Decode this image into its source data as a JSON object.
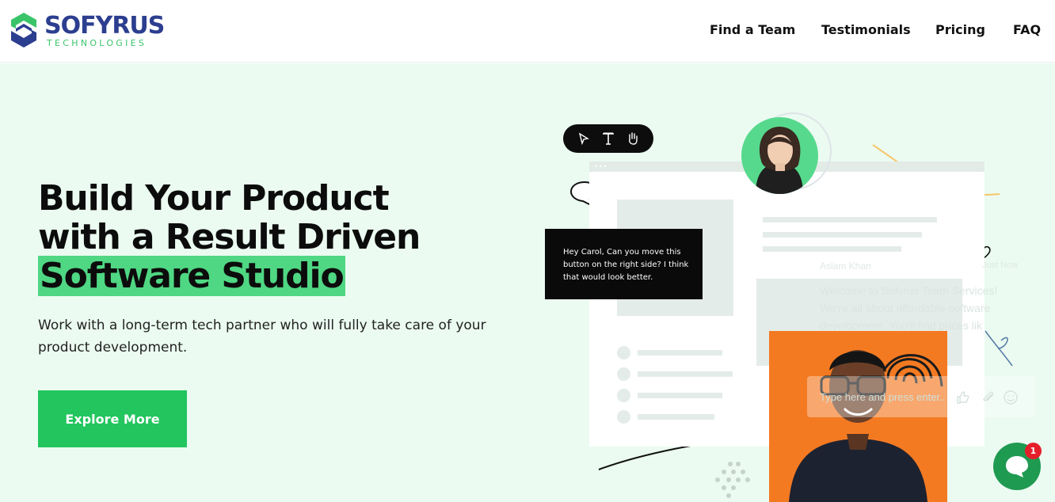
{
  "brand": {
    "name": "SOFYRUS",
    "tagline": "TECHNOLOGIES",
    "colors": {
      "navy": "#2c3e8f",
      "green": "#3ac46a"
    }
  },
  "nav": {
    "items": [
      {
        "label": "Find a Team"
      },
      {
        "label": "Testimonials"
      },
      {
        "label": "Pricing"
      },
      {
        "label": "FAQ"
      }
    ]
  },
  "hero": {
    "title_line1": "Build Your Product",
    "title_line2": "with a Result Driven",
    "title_highlight": "Software Studio",
    "subtitle": "Work with a long-term tech partner who will fully take care of your product development.",
    "cta_label": "Explore More",
    "colors": {
      "background": "#ebfbf1",
      "highlight": "#4fd783",
      "cta": "#22c55e"
    }
  },
  "illustration": {
    "toolbar_icons": [
      "cursor-icon",
      "text-tool-icon",
      "hand-icon"
    ],
    "speech_bubble_text": "Hey Carol, Can you move this button on the right side? I think that would look better.",
    "chat_overlay": {
      "agent_name": "Aslam Khan",
      "status": "Just Now",
      "message_line1": "Welcome to Sofyrus Team Services!",
      "message_line2": "We're all about affordable software",
      "message_line3": "development. You'll find prices lik",
      "input_placeholder": "Type here and press enter.."
    }
  },
  "chat_widget": {
    "icon": "chat-bubble-icon",
    "unread_count": "1",
    "colors": {
      "button": "#1f9a51",
      "badge": "#e51e2a"
    }
  }
}
